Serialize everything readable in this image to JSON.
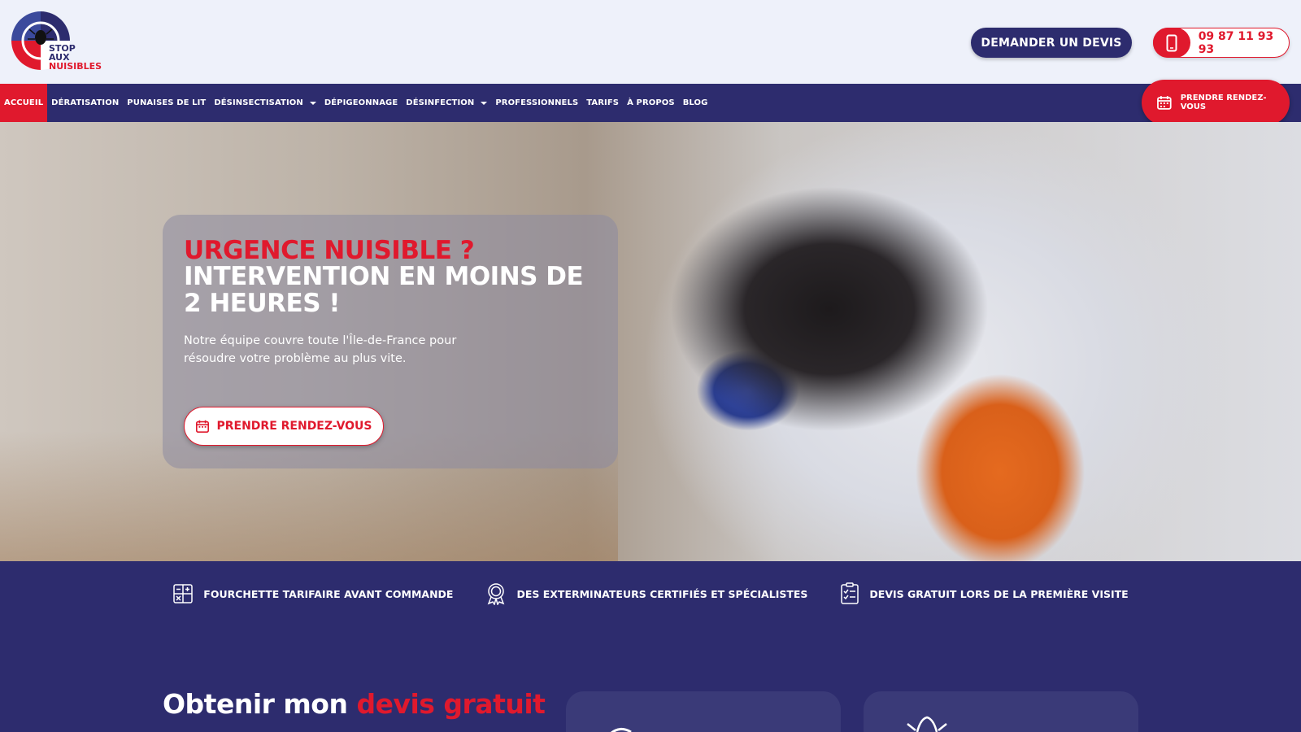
{
  "brand": {
    "logo_lines": [
      "STOP",
      "AUX",
      "NUISIBLES"
    ],
    "colors": {
      "navy": "#2d2c6e",
      "red": "#e0192d"
    }
  },
  "header": {
    "devis_label": "DEMANDER UN DEVIS",
    "phone_icon": "phone-icon",
    "phone_number": "09 87 11 93 93"
  },
  "nav": {
    "items": [
      {
        "label": "ACCUEIL",
        "active": true
      },
      {
        "label": "DÉRATISATION"
      },
      {
        "label": "PUNAISES DE LIT"
      },
      {
        "label": "DÉSINSECTISATION",
        "dropdown": true
      },
      {
        "label": "DÉPIGEONNAGE"
      },
      {
        "label": "DÉSINFECTION",
        "dropdown": true
      },
      {
        "label": "PROFESSIONNELS"
      },
      {
        "label": "TARIFS"
      },
      {
        "label": "À PROPOS"
      },
      {
        "label": "BLOG"
      }
    ],
    "rdv_label": "PRENDRE RENDEZ-VOUS"
  },
  "hero": {
    "title_red": "URGENCE NUISIBLE ?",
    "title": "INTERVENTION EN MOINS DE 2 HEURES !",
    "description": "Notre équipe couvre toute l'Île-de-France pour résoudre votre problème au plus vite.",
    "cta_label": "PRENDRE RENDEZ-VOUS"
  },
  "features": [
    {
      "icon": "price-grid-icon",
      "label": "FOURCHETTE TARIFAIRE AVANT COMMANDE"
    },
    {
      "icon": "certified-badge-icon",
      "label": "DES EXTERMINATEURS CERTIFIÉS ET SPÉCIALISTES"
    },
    {
      "icon": "checklist-icon",
      "label": "DEVIS GRATUIT LORS DE LA PREMIÈRE VISITE"
    }
  ],
  "quote_section": {
    "title_start": "Obtenir mon ",
    "title_red": "devis gratuit"
  }
}
